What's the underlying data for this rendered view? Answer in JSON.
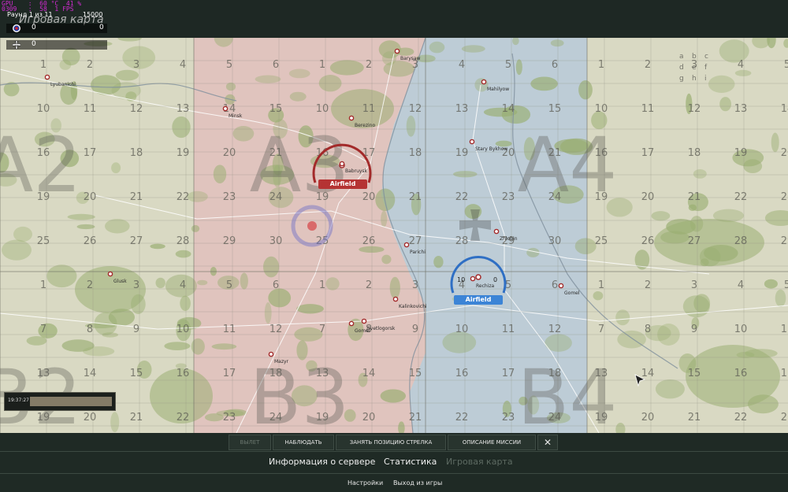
{
  "hud": {
    "perf_lines": [
      "GPU    :  60 °C  41 %",
      "0309   :  58  1 FPS"
    ],
    "round_text": "Раунд 1 из 11",
    "score_limit": "15000",
    "map_title": "Игровая карта",
    "team_allied": {
      "icon": "allied-roundel-icon",
      "score": "0",
      "score_right": "0"
    },
    "team_axis": {
      "icon": "iron-cross-icon",
      "score": "0"
    }
  },
  "map": {
    "colors": {
      "base": "#d9d9c3",
      "red_zone": "#e3bfbf",
      "blue_zone": "#b7c9dc",
      "forest": "#9aae72",
      "grid": "#8a8a7c",
      "red": "#a32a2a",
      "blue": "#2f6fc4"
    },
    "sector_labels": [
      "A2",
      "A3",
      "A4",
      "B2",
      "B3",
      "B4"
    ],
    "column_numbers": [
      "1",
      "2",
      "3",
      "4",
      "5",
      "6",
      "7",
      "8",
      "9",
      "10",
      "11",
      "12",
      "13",
      "14",
      "15",
      "16",
      "17",
      "18",
      "19",
      "20",
      "21",
      "22",
      "23",
      "24",
      "25",
      "26",
      "27",
      "28",
      "29",
      "30"
    ],
    "subgrid_letters": [
      "a",
      "b",
      "c",
      "d",
      "e",
      "f",
      "g",
      "h",
      "i"
    ],
    "towns": [
      "Barysaw",
      "Mahilyow",
      "Minsk",
      "Berezino",
      "Stary Bykhow",
      "Babruysk",
      "Zhlobin",
      "Parichi",
      "Rechiza",
      "Gomel",
      "Kalinkovichi",
      "Gomel",
      "Mazyr",
      "Svetlogorsk",
      "Glusk",
      "Lyubanichi"
    ],
    "airfield_red": {
      "label": "Airfield"
    },
    "airfield_blue": {
      "label": "Airfield",
      "left_count": "10",
      "right_count": "0"
    },
    "cursor": "pointer-cursor-icon"
  },
  "timeline": {
    "time": "19:37:27"
  },
  "actions": {
    "buttons": [
      "ВЫЛЕТ",
      "НАБЛЮДАТЬ",
      "ЗАНЯТЬ ПОЗИЦИЮ СТРЕЛКА",
      "ОПИСАНИЕ МИССИИ"
    ],
    "close_icon": "close-icon"
  },
  "tabs": [
    "Информация о сервере",
    "Статистика",
    "Игровая карта"
  ],
  "footer": {
    "settings": "Настройки",
    "exit": "Выход из игры"
  }
}
